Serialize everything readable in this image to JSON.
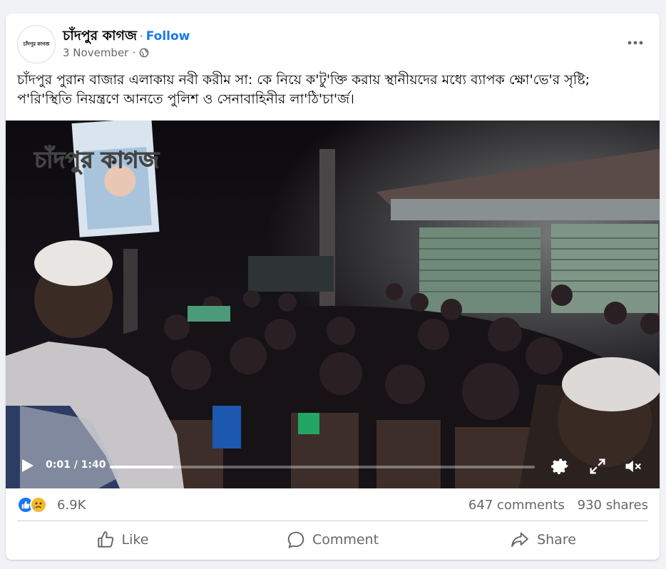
{
  "post": {
    "page_name": "চাঁদপুর কাগজ",
    "separator": "·",
    "follow_label": "Follow",
    "date": "3 November",
    "date_separator": "·",
    "avatar_text": "চাঁদপুর কাগজ",
    "text": "চাঁদপুর পুরান বাজার এলাকায় নবী করীম সা: কে নিয়ে ক'টু'ক্তি করায় স্থানীয়দের মধ্যে ব্যাপক ক্ষো'ভে'র সৃষ্টি;  প'রি'স্থিতি নিয়ন্ত্রণে আনতে পুলিশ ও সেনাবাহিনীর লা'ঠি'চা'র্জ।"
  },
  "video": {
    "watermark": "চাঁদপুর কাগজ",
    "time": "0:01 / 1:40",
    "progress_fraction": 0.15
  },
  "engagement": {
    "reaction_icons": [
      "like-icon",
      "sad-icon"
    ],
    "reaction_count": "6.9K",
    "comments": "647 comments",
    "shares": "930 shares"
  },
  "actions": {
    "like": "Like",
    "comment": "Comment",
    "share": "Share"
  },
  "colors": {
    "accent": "#1877f2",
    "secondary_text": "#65676b",
    "background": "#f0f2f5"
  }
}
